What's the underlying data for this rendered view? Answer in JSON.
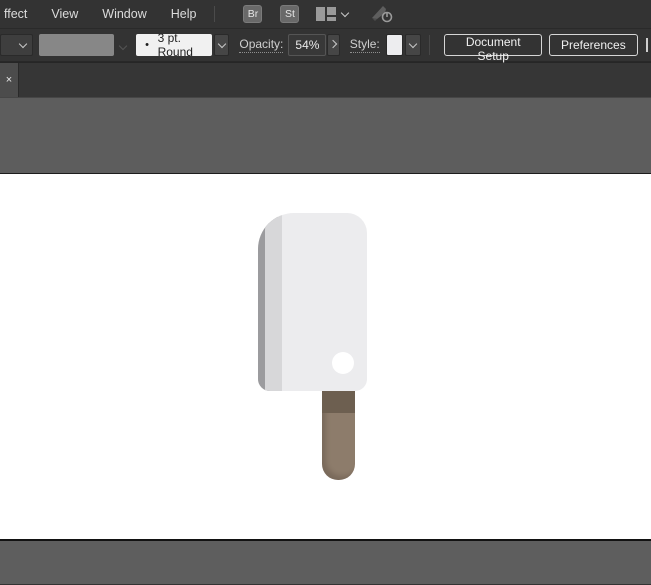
{
  "menu_bar": {
    "items": [
      "ffect",
      "View",
      "Window",
      "Help"
    ],
    "bridge_label": "Br",
    "stock_label": "St"
  },
  "control_bar": {
    "brush": {
      "bullet": "•",
      "value": "3 pt. Round"
    },
    "opacity_label": "Opacity:",
    "opacity_value": "54%",
    "style_label": "Style:",
    "document_setup_label": "Document Setup",
    "preferences_label": "Preferences"
  },
  "tab_bar": {
    "close_glyph": "×"
  },
  "colors": {
    "chrome_bg": "#333333",
    "pasteboard": "#5d5d5d",
    "artboard": "#ffffff",
    "popsicle_body": "#ececee",
    "popsicle_shade_mid": "#d7d7d9",
    "popsicle_shade_dark": "#9b9b9e",
    "stick": "#8d7c6b",
    "stick_shadow": "#6d5f50",
    "dot": "#ffffff",
    "brush_preview": "#878787"
  }
}
